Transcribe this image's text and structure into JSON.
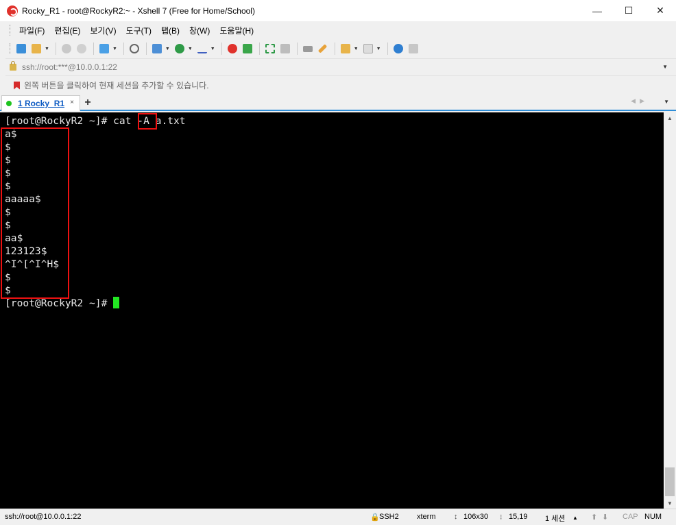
{
  "window": {
    "title": "Rocky_R1 - root@RockyR2:~ - Xshell 7 (Free for Home/School)",
    "minimize_glyph": "—",
    "maximize_glyph": "☐",
    "close_glyph": "✕"
  },
  "menu": {
    "items": [
      "파일(F)",
      "편집(E)",
      "보기(V)",
      "도구(T)",
      "탭(B)",
      "창(W)",
      "도움말(H)"
    ]
  },
  "toolbar": {
    "icons": [
      "new-session-icon",
      "open-folder-icon",
      "reconnect-icon",
      "disconnect-icon",
      "properties-icon",
      "find-icon",
      "transfer-icon",
      "globe-icon",
      "font-icon",
      "xftp-icon",
      "xmanager-icon",
      "fullscreen-icon",
      "lock-icon",
      "keyboard-icon",
      "highlight-icon",
      "compose-icon",
      "layout-icon",
      "help-icon",
      "chat-icon"
    ]
  },
  "address": {
    "text": "ssh://root:***@10.0.0.1:22"
  },
  "hint": {
    "text": "왼쪽 버튼을 클릭하여 현재 세션을 추가할 수 있습니다."
  },
  "tabs": [
    {
      "label": "1 Rocky_R1",
      "close_glyph": "×",
      "active": true
    }
  ],
  "tab_add_glyph": "+",
  "terminal": {
    "lines": [
      "[root@RockyR2 ~]# cat -A a.txt",
      "a$",
      "$",
      "$",
      "$",
      "$",
      "aaaaa$",
      "$",
      "$",
      "aa$",
      "123123$",
      "^I^[^I^H$",
      "$",
      "$",
      "[root@RockyR2 ~]# "
    ],
    "colors": {
      "background": "#000000",
      "foreground": "#e8e8e8",
      "cursor": "#22e622",
      "highlight_box": "#ee1111"
    }
  },
  "status": {
    "connection": "ssh://root@10.0.0.1:22",
    "protocol": "SSH2",
    "terminal_type": "xterm",
    "size": "106x30",
    "position": "15,19",
    "sessions": "1 세션",
    "caps": "CAP",
    "num": "NUM"
  }
}
